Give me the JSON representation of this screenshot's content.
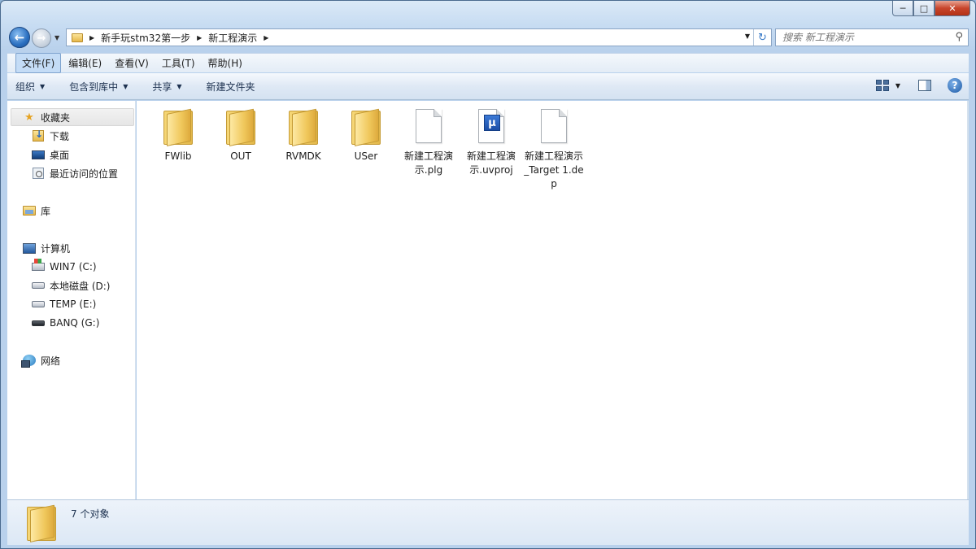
{
  "window": {
    "caption_buttons": {
      "minimize": "─",
      "maximize": "□",
      "close": "✕"
    }
  },
  "address": {
    "crumbs": [
      "新手玩stm32第一步",
      "新工程演示"
    ],
    "search_placeholder": "搜索 新工程演示"
  },
  "menu": {
    "items": [
      "文件(F)",
      "编辑(E)",
      "查看(V)",
      "工具(T)",
      "帮助(H)"
    ],
    "active_index": 0
  },
  "toolbar": {
    "organize": "组织",
    "include_in_library": "包含到库中",
    "share": "共享",
    "new_folder": "新建文件夹"
  },
  "nav": {
    "favorites": "收藏夹",
    "downloads": "下载",
    "desktop": "桌面",
    "recent": "最近访问的位置",
    "libraries": "库",
    "computer": "计算机",
    "drives": [
      "WIN7 (C:)",
      "本地磁盘 (D:)",
      "TEMP (E:)",
      "BANQ (G:)"
    ],
    "network": "网络"
  },
  "files": [
    {
      "name": "FWlib",
      "type": "folder-icon"
    },
    {
      "name": "OUT",
      "type": "folder-icon"
    },
    {
      "name": "RVMDK",
      "type": "folder-icon"
    },
    {
      "name": "USer",
      "type": "folder-icon"
    },
    {
      "name": "新建工程演示.plg",
      "type": "document-icon"
    },
    {
      "name": "新建工程演示.uvproj",
      "type": "uvision-project-icon"
    },
    {
      "name": "新建工程演示_Target 1.dep",
      "type": "document-icon"
    }
  ],
  "status": {
    "item_count": "7 个对象"
  }
}
